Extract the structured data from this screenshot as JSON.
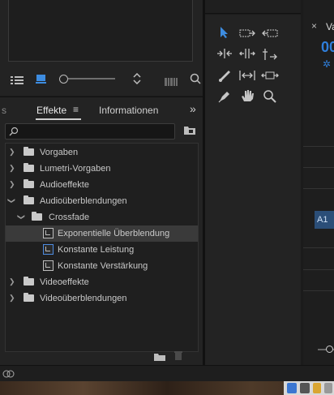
{
  "effects_panel": {
    "tabs": [
      {
        "label": "Effekte",
        "active": true
      },
      {
        "label": "Informationen",
        "active": false
      }
    ],
    "overflow_label": "»",
    "search_placeholder": "",
    "tree": [
      {
        "label": "Vorgaben",
        "type": "folder-special",
        "level": 0,
        "expanded": false
      },
      {
        "label": "Lumetri-Vorgaben",
        "type": "folder-special",
        "level": 0,
        "expanded": false
      },
      {
        "label": "Audioeffekte",
        "type": "folder",
        "level": 0,
        "expanded": false
      },
      {
        "label": "Audioüberblendungen",
        "type": "folder",
        "level": 0,
        "expanded": true
      },
      {
        "label": "Crossfade",
        "type": "folder",
        "level": 1,
        "expanded": true
      },
      {
        "label": "Exponentielle Überblendung",
        "type": "effect",
        "level": 2,
        "selected": true
      },
      {
        "label": "Konstante Leistung",
        "type": "effect",
        "level": 2
      },
      {
        "label": "Konstante Verstärkung",
        "type": "effect",
        "level": 2
      },
      {
        "label": "Videoeffekte",
        "type": "folder",
        "level": 0,
        "expanded": false
      },
      {
        "label": "Videoüberblendungen",
        "type": "folder",
        "level": 0,
        "expanded": false
      }
    ]
  },
  "timeline": {
    "tab_close": "×",
    "tab_label": "Va",
    "timecode": "00",
    "track_label": "A1"
  },
  "colors": {
    "accent": "#2f7fdc",
    "selected_row": "#3a3a3a"
  }
}
